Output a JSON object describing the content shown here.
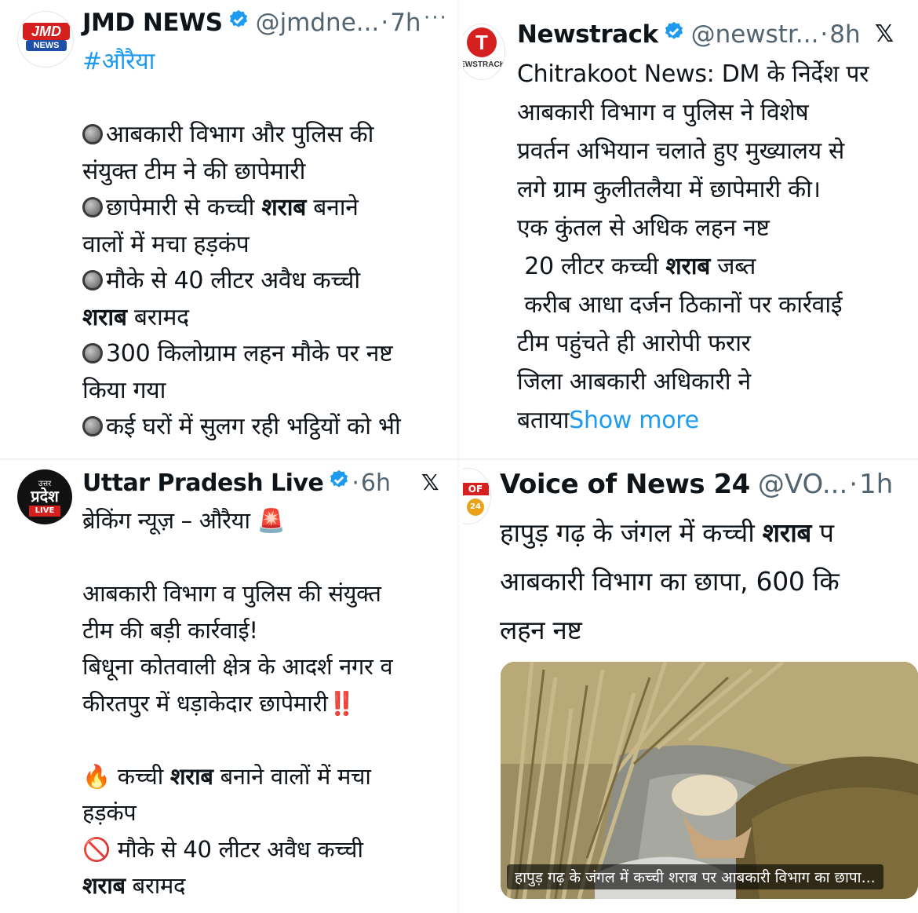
{
  "panels": [
    {
      "name": "JMD NEWS",
      "handle": "@jmdne...",
      "time": "7h",
      "more": "···",
      "avatar_text": "JMD",
      "avatar_sub": "NEWS",
      "hashtag": "#औरैया",
      "lines": [
        "आबकारी विभाग और पुलिस की",
        "संयुक्त टीम ने की छापेमारी",
        "छापेमारी से कच्ची ",
        "शराब",
        " बनाने",
        "वालों में मचा हड़कंप",
        "मौके से 40 लीटर अवैध कच्ची",
        "शराब",
        " बरामद",
        "300 किलोग्राम लहन मौके पर नष्ट",
        "किया गया",
        "कई घरों में सुलग रही भट्ठियों को भी"
      ]
    },
    {
      "name": "Newstrack",
      "handle": "@newstr...",
      "time": "8h",
      "x_icon": "𝕏",
      "avatar_text": "EWSTRACK",
      "lines": [
        "Chitrakoot News: DM के निर्देश पर",
        "आबकारी विभाग व पुलिस ने विशेष",
        "प्रवर्तन अभियान चलाते हुए मुख्यालय से",
        "लगे ग्राम कुलीतलैया में छापेमारी की।",
        "एक कुंतल से अधिक लहन नष्ट",
        " 20 लीटर कच्ची ",
        "शराब",
        " जब्त",
        " करीब आधा दर्जन ठिकानों पर कार्रवाई",
        "टीम पहुंचते ही आरोपी फरार",
        "जिला आबकारी अधिकारी ने",
        "बताया"
      ],
      "show_more": "Show more"
    },
    {
      "name": "Uttar Pradesh Live",
      "handle": "",
      "time": "6h",
      "x_icon": "𝕏",
      "avatar_text": "प्रदेश",
      "avatar_sub": "LIVE",
      "avatar_top": "उत्तर",
      "lines": [
        "ब्रेकिंग न्यूज़ – औरैया",
        "आबकारी विभाग व पुलिस की संयुक्त",
        "टीम की बड़ी कार्रवाई!",
        "बिधूना कोतवाली क्षेत्र के आदर्श नगर व",
        "कीरतपुर में धड़ाकेदार छापेमारी",
        "‼️",
        "🔥",
        " कच्ची ",
        "शराब",
        " बनाने वालों में मचा",
        "हड़कंप",
        "🚫",
        " मौके से 40 लीटर अवैध कच्ची",
        "शराब",
        " बरामद"
      ],
      "emoji_siren": "🚨"
    },
    {
      "name": "Voice of News 24",
      "handle": "@VO...",
      "time": "1h",
      "avatar_text": "OF",
      "avatar_sub": "24",
      "lines": [
        "हापुड़ गढ़ के जंगल में कच्ची ",
        "शराब",
        " प",
        "आबकारी विभाग का छापा, 600 कि",
        "लहन नष्ट"
      ],
      "media_caption": "हापुड़ गढ़ के जंगल में कच्ची शराब पर आबकारी विभाग का छापा..."
    }
  ],
  "colors": {
    "link": "#1d9bf0",
    "verified": "#1d9bf0",
    "secondary": "#536471",
    "text": "#0f1419"
  },
  "icons": {
    "verified": "verified-badge-icon",
    "x": "x-logo-icon",
    "more": "more-options-icon",
    "bullet": "grey-circle-icon"
  }
}
